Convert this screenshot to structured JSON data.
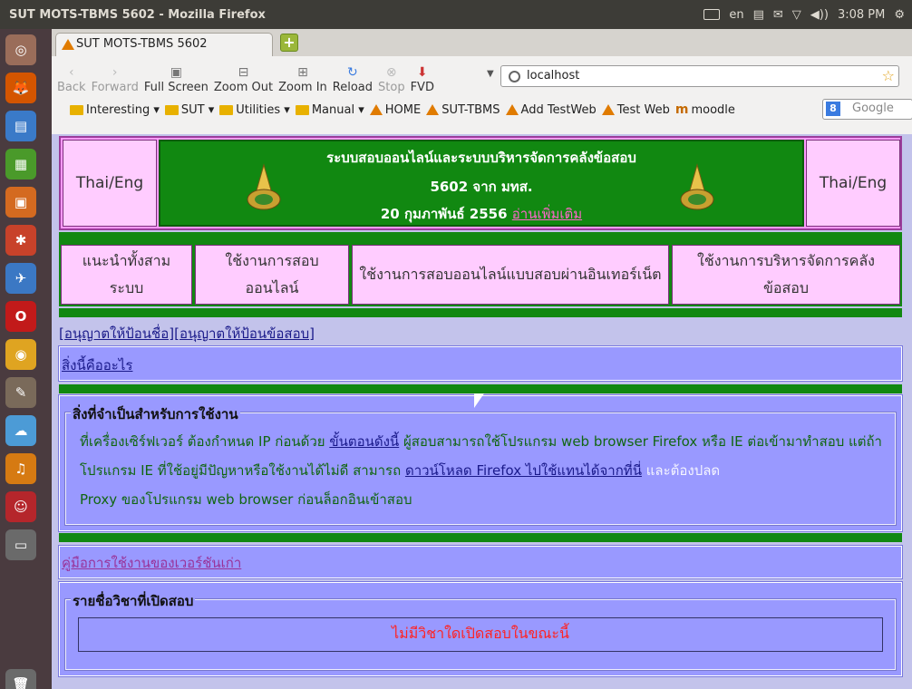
{
  "panel": {
    "window_title": "SUT MOTS-TBMS 5602 - Mozilla Firefox",
    "keyboard": "en",
    "time": "3:08 PM"
  },
  "launcher": {
    "items": [
      {
        "name": "dash-icon",
        "glyph": "◎",
        "color": "#9a6d5a"
      },
      {
        "name": "firefox-icon",
        "glyph": "🦊",
        "color": "#d45500"
      },
      {
        "name": "writer-icon",
        "glyph": "▤",
        "color": "#3a7ac8"
      },
      {
        "name": "calc-icon",
        "glyph": "▦",
        "color": "#4a9a2a"
      },
      {
        "name": "impress-icon",
        "glyph": "▣",
        "color": "#d46a20"
      },
      {
        "name": "tools-icon",
        "glyph": "✱",
        "color": "#c8422a"
      },
      {
        "name": "thunderbird-icon",
        "glyph": "✈",
        "color": "#3b78c4"
      },
      {
        "name": "opera-icon",
        "glyph": "O",
        "color": "#c21a1a"
      },
      {
        "name": "chrome-icon",
        "glyph": "◉",
        "color": "#dfa421"
      },
      {
        "name": "gimp-icon",
        "glyph": "✎",
        "color": "#7a6a5a"
      },
      {
        "name": "ubuntu-one-icon",
        "glyph": "☁",
        "color": "#4c9bd6"
      },
      {
        "name": "media-icon",
        "glyph": "♫",
        "color": "#d67a12"
      },
      {
        "name": "chat-icon",
        "glyph": "☺",
        "color": "#b5262b"
      },
      {
        "name": "workspace-icon",
        "glyph": "▭",
        "color": "#6a6a6a"
      },
      {
        "name": "trash-icon",
        "glyph": "🗑",
        "color": "#6a6a6a"
      }
    ]
  },
  "tab": {
    "title": "SUT MOTS-TBMS 5602"
  },
  "nav": {
    "back": "Back",
    "forward": "Forward",
    "fullscreen": "Full Screen",
    "zoom_out": "Zoom Out",
    "zoom_in": "Zoom In",
    "reload": "Reload",
    "stop": "Stop",
    "fvd": "FVD",
    "url": "localhost",
    "search_placeholder": "Google"
  },
  "bookmarks": [
    {
      "label": "Interesting ▾",
      "kind": "folder"
    },
    {
      "label": "SUT ▾",
      "kind": "folder"
    },
    {
      "label": "Utilities ▾",
      "kind": "folder"
    },
    {
      "label": "Manual ▾",
      "kind": "folder"
    },
    {
      "label": "HOME",
      "kind": "tri"
    },
    {
      "label": "SUT-TBMS",
      "kind": "tri"
    },
    {
      "label": "Add TestWeb",
      "kind": "tri"
    },
    {
      "label": "Test Web",
      "kind": "tri"
    },
    {
      "label": "moodle",
      "kind": "moodle"
    }
  ],
  "header": {
    "thai_eng_left": "Thai/Eng",
    "thai_eng_right": "Thai/Eng",
    "line1": "ระบบสอบออนไลน์และระบบบริหารจัดการคลังข้อสอบ",
    "line2": "5602 จาก มทส.",
    "line3_date": "20 กุมภาพันธ์ 2556",
    "line3_link": "อ่านเพิ่มเติม"
  },
  "menu": [
    {
      "label": "แนะนำทั้งสามระบบ"
    },
    {
      "label": "ใช้งานการสอบออนไลน์"
    },
    {
      "label": "ใช้งานการสอบออนไลน์แบบสอบผ่านอินเทอร์เน็ต"
    },
    {
      "label": "ใช้งานการบริหารจัดการคลังข้อสอบ"
    }
  ],
  "links": {
    "allow_name": "[อนุญาตให้ป้อนชื่อ]",
    "allow_exam": "[อนุญาตให้ป้อนข้อสอบ]",
    "what_is_this": "สิ่งนี้คืออะไร",
    "old_manual": "คู่มือการใช้งานของเวอร์ชันเก่า"
  },
  "requirements": {
    "legend": "สิ่งที่จำเป็นสำหรับการใช้งาน",
    "p1": "ที่เครื่องเซิร์ฟเวอร์ ต้องกำหนด IP ก่อนด้วย ",
    "p1_link": "ขั้นตอนดังนี้",
    "p2": " ผู้สอบสามารถใช้โปรแกรม web browser Firefox หรือ IE ต่อเข้ามาทำสอบ แต่ถ้าโปรแกรม IE ที่ใช้อยู่มีปัญหาหรือใช้งานได้ไม่ดี สามารถ ",
    "p2_link": "ดาวน์โหลด Firefox ไปใช้แทนได้จากที่นี่",
    "p3_pale": " และต้องปลด",
    "p4": "Proxy ของโปรแกรม web browser ก่อนล็อกอินเข้าสอบ"
  },
  "courses": {
    "legend": "รายชื่อวิชาที่เปิดสอบ",
    "none": "ไม่มีวิชาใดเปิดสอบในขณะนี้"
  }
}
